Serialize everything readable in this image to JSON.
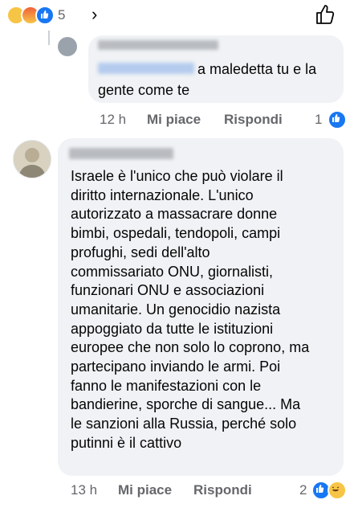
{
  "top_bar": {
    "reaction_icons": [
      "sad-reaction",
      "angry-reaction",
      "like-reaction"
    ],
    "reaction_count": "5",
    "chevron_icon": "chevron-right-icon",
    "like_icon": "thumbs-up-outline-icon"
  },
  "reply1": {
    "text_line1": "a maledetta tu e la",
    "text_line2": "gente come te",
    "time": "12 h",
    "like_label": "Mi piace",
    "reply_label": "Rispondi",
    "reaction_count": "1"
  },
  "comment2": {
    "body": "Israele è l'unico che può violare il\ndiritto internazionale. L'unico\nautorizzato a massacrare donne\nbimbi, ospedali, tendopoli, campi\nprofughi, sedi dell'alto\ncommissariato ONU, giornalisti,\nfunzionari ONU e associazioni\numanitarie. Un genocidio nazista\nappoggiato da tutte le istituzioni\neuropee che non solo lo coprono, ma\npartecipano inviando le armi. Poi\nfanno le manifestazioni con le\nbandierine, sporche di sangue... Ma\nle sanzioni alla Russia, perché solo\nputinni è il cattivo",
    "time": "13 h",
    "like_label": "Mi piace",
    "reply_label": "Rispondi",
    "reaction_count": "2"
  },
  "colors": {
    "bubble": "#f0f2f5",
    "meta_text": "#65676b",
    "like_blue": "#1877f2"
  }
}
